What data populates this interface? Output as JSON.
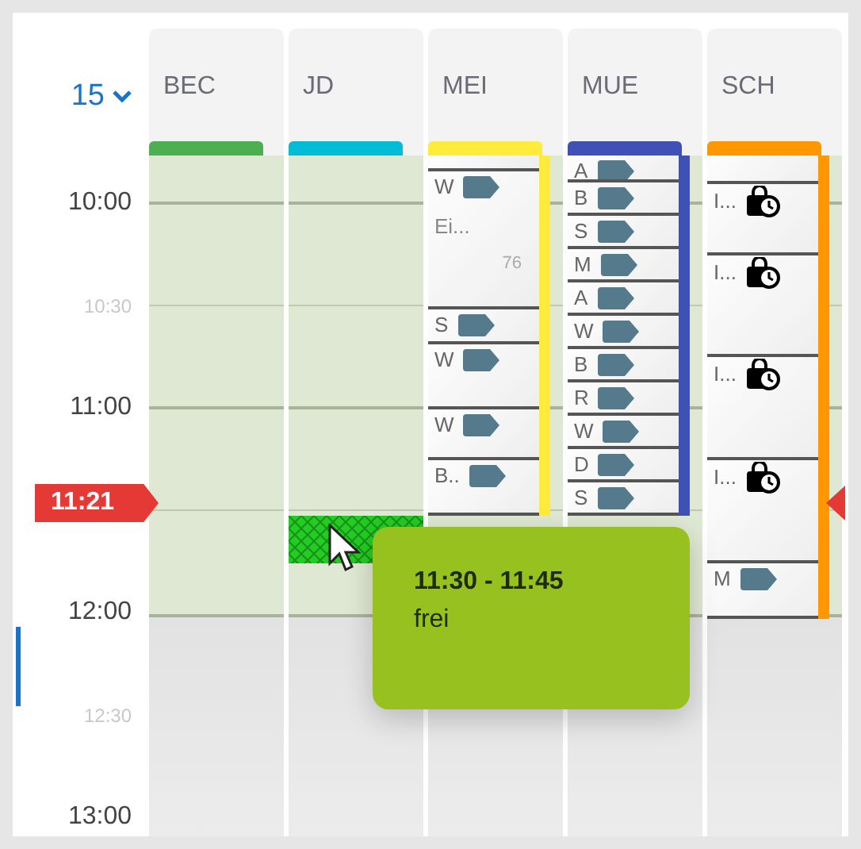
{
  "time_picker": {
    "value": "15"
  },
  "columns": [
    {
      "label": "BEC",
      "color": "#4caf50"
    },
    {
      "label": "JD",
      "color": "#00bcd4"
    },
    {
      "label": "MEI",
      "color": "#ffeb3b",
      "events": [
        {
          "kind": "blank"
        },
        {
          "kind": "tag",
          "label": "W",
          "note": "Ei...",
          "extra": "76"
        },
        {
          "kind": "tag",
          "label": "S"
        },
        {
          "kind": "tag",
          "label": "W"
        },
        {
          "kind": "tag",
          "label": "W"
        },
        {
          "kind": "tag",
          "label": "B.."
        }
      ]
    },
    {
      "label": "MUE",
      "color": "#3f51b5",
      "events": [
        {
          "kind": "tag",
          "label": "A"
        },
        {
          "kind": "tag",
          "label": "B"
        },
        {
          "kind": "tag",
          "label": "S"
        },
        {
          "kind": "tag",
          "label": "M"
        },
        {
          "kind": "tag",
          "label": "A"
        },
        {
          "kind": "tag",
          "label": "W"
        },
        {
          "kind": "tag",
          "label": "B"
        },
        {
          "kind": "tag",
          "label": "R"
        },
        {
          "kind": "tag",
          "label": "W"
        },
        {
          "kind": "tag",
          "label": "D"
        },
        {
          "kind": "tag",
          "label": "S"
        }
      ]
    },
    {
      "label": "SCH",
      "color": "#ff9800",
      "events": [
        {
          "kind": "blank"
        },
        {
          "kind": "clock",
          "label": "I..."
        },
        {
          "kind": "clock",
          "label": "I..."
        },
        {
          "kind": "clock",
          "label": "I..."
        },
        {
          "kind": "clock",
          "label": "I..."
        },
        {
          "kind": "tag",
          "label": "M"
        }
      ]
    }
  ],
  "time_labels": [
    {
      "text": "10:00",
      "kind": "full"
    },
    {
      "text": "10:30",
      "kind": "half"
    },
    {
      "text": "11:00",
      "kind": "full"
    },
    {
      "text": "12:00",
      "kind": "full"
    },
    {
      "text": "12:30",
      "kind": "half"
    },
    {
      "text": "13:00",
      "kind": "full"
    }
  ],
  "now_marker": "11:21",
  "tooltip": {
    "time": "11:30 - 11:45",
    "status": "frei"
  }
}
